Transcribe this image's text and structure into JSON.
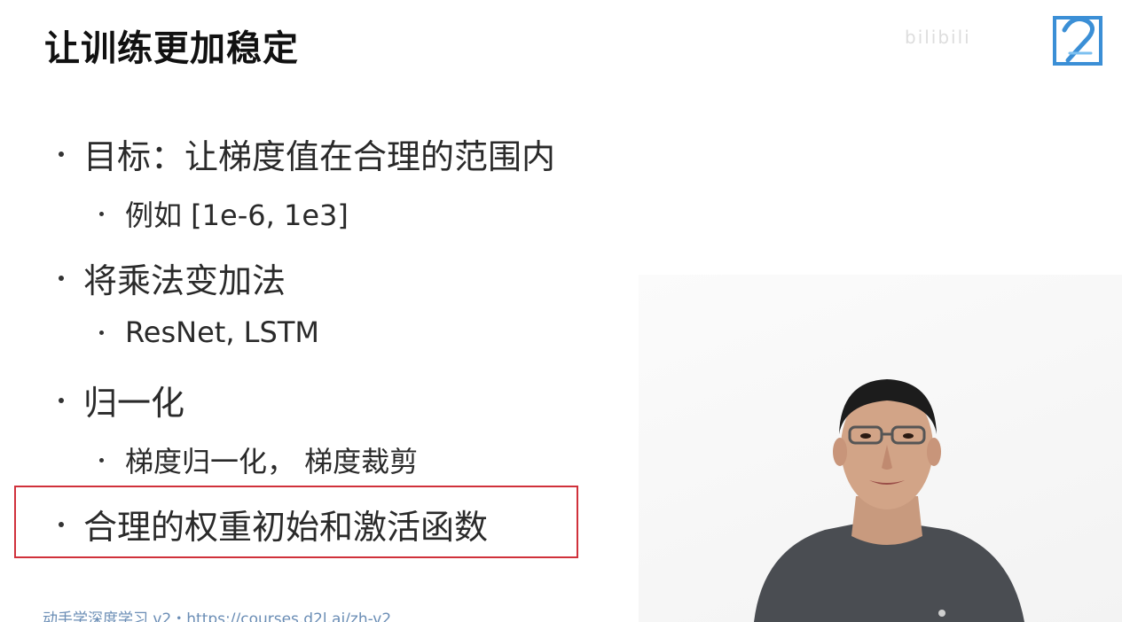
{
  "slide": {
    "title": "让训练更加稳定",
    "bullets": [
      {
        "level": 1,
        "text": "目标：让梯度值在合理的范围内"
      },
      {
        "level": 2,
        "text": "例如 [1e-6, 1e3]"
      },
      {
        "level": 1,
        "text": "将乘法变加法"
      },
      {
        "level": 2,
        "text": "ResNet, LSTM"
      },
      {
        "level": 1,
        "text": "归一化"
      },
      {
        "level": 2,
        "text": "梯度归一化， 梯度裁剪"
      },
      {
        "level": 1,
        "text": "合理的权重初始和激活函数",
        "highlighted": true
      }
    ],
    "footer": "动手学深度学习 v2・https://courses.d2l.ai/zh-v2"
  },
  "overlay": {
    "logo_icon": "d2l-logo-icon",
    "watermark": "bilibili",
    "highlight_color": "#d0313b",
    "footer_color": "#6a8db5"
  },
  "presenter": {
    "icon": "presenter-video-icon"
  }
}
